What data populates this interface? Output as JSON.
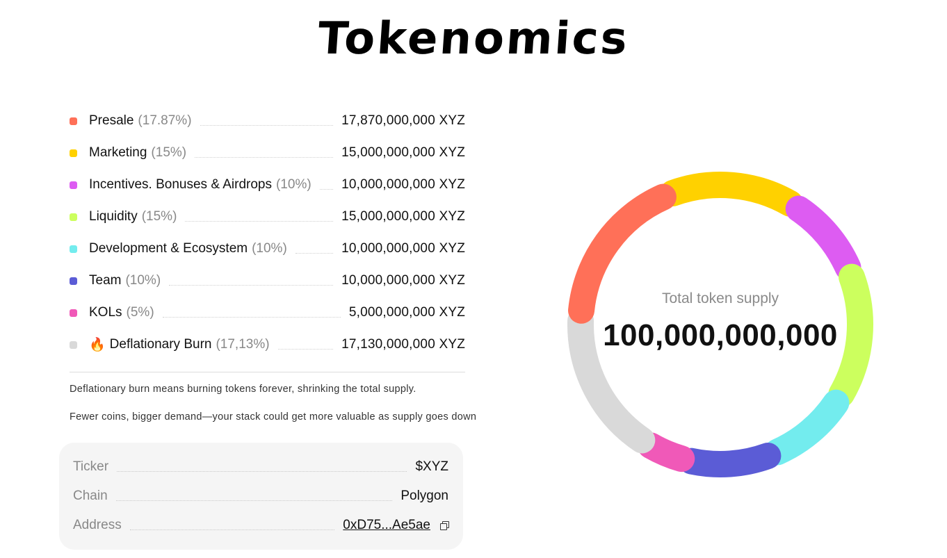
{
  "title": "Tokenomics",
  "allocations": [
    {
      "name": "Presale",
      "pct": "(17.87%)",
      "amount": "17,870,000,000 XYZ",
      "share": 17.87,
      "color": "#FF7058"
    },
    {
      "name": "Marketing",
      "pct": "(15%)",
      "amount": "15,000,000,000 XYZ",
      "share": 15,
      "color": "#FFD100"
    },
    {
      "name": "Incentives. Bonuses & Airdrops",
      "pct": "(10%)",
      "amount": "10,000,000,000 XYZ",
      "share": 10,
      "color": "#DD5CF2"
    },
    {
      "name": "Liquidity",
      "pct": "(15%)",
      "amount": "15,000,000,000 XYZ",
      "share": 15,
      "color": "#CCFF5E"
    },
    {
      "name": "Development & Ecosystem",
      "pct": "(10%)",
      "amount": "10,000,000,000 XYZ",
      "share": 10,
      "color": "#73ECEE"
    },
    {
      "name": "Team",
      "pct": "(10%)",
      "amount": "10,000,000,000 XYZ",
      "share": 10,
      "color": "#5B5CD6"
    },
    {
      "name": "KOLs",
      "pct": "(5%)",
      "amount": "5,000,000,000 XYZ",
      "share": 5,
      "color": "#F059B8"
    },
    {
      "name": "Deflationary Burn",
      "pct": "(17,13%)",
      "amount": "17,130,000,000 XYZ",
      "share": 17.13,
      "color": "#D9D9D9",
      "emoji": "🔥"
    }
  ],
  "notes": {
    "line1": "Deflationary burn means burning tokens forever, shrinking the total supply.",
    "line2": "Fewer coins, bigger demand—your stack could get more valuable as supply goes down"
  },
  "token_info": {
    "ticker_label": "Ticker",
    "ticker_value": "$XYZ",
    "chain_label": "Chain",
    "chain_value": "Polygon",
    "address_label": "Address",
    "address_value": "0xD75...Ae5ae"
  },
  "supply": {
    "label": "Total token supply",
    "value": "100,000,000,000"
  }
}
